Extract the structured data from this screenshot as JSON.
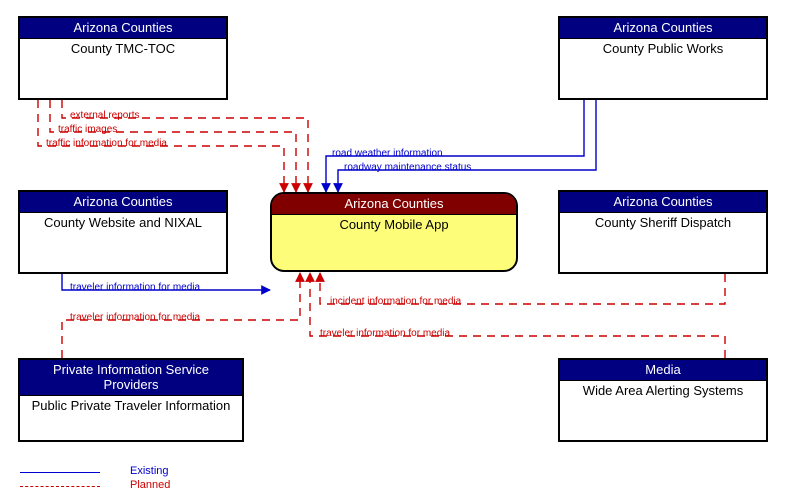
{
  "boxes": {
    "tmc": {
      "header": "Arizona Counties",
      "title": "County TMC-TOC"
    },
    "public_works": {
      "header": "Arizona Counties",
      "title": "County Public Works"
    },
    "website": {
      "header": "Arizona Counties",
      "title": "County Website and NIXAL"
    },
    "mobile": {
      "header": "Arizona Counties",
      "title": "County Mobile App"
    },
    "sheriff": {
      "header": "Arizona Counties",
      "title": "County Sheriff Dispatch"
    },
    "traveler_info": {
      "header": "Private Information Service Providers",
      "title": "Public  Private Traveler Information"
    },
    "media": {
      "header": "Media",
      "title": "Wide Area Alerting Systems"
    }
  },
  "flows": {
    "external_reports": "external reports",
    "traffic_images": "traffic images",
    "traffic_info_media": "traffic information for media",
    "road_weather": "road weather information",
    "roadway_maint": "roadway maintenance status",
    "traveler_info_media_1": "traveler information for media",
    "traveler_info_media_2": "traveler information for media",
    "incident_info": "incident information for media",
    "traveler_info_media_3": "traveler information for media"
  },
  "legend": {
    "existing": "Existing",
    "planned": "Planned"
  },
  "chart_data": {
    "type": "diagram",
    "title": "County Mobile App context diagram",
    "nodes": [
      {
        "id": "mobile",
        "label": "County Mobile App",
        "owner": "Arizona Counties",
        "role": "center"
      },
      {
        "id": "tmc",
        "label": "County TMC-TOC",
        "owner": "Arizona Counties"
      },
      {
        "id": "public_works",
        "label": "County Public Works",
        "owner": "Arizona Counties"
      },
      {
        "id": "website",
        "label": "County Website and NIXAL",
        "owner": "Arizona Counties"
      },
      {
        "id": "sheriff",
        "label": "County Sheriff Dispatch",
        "owner": "Arizona Counties"
      },
      {
        "id": "traveler_info",
        "label": "Public  Private Traveler Information",
        "owner": "Private Information Service Providers"
      },
      {
        "id": "media",
        "label": "Wide Area Alerting Systems",
        "owner": "Media"
      }
    ],
    "edges": [
      {
        "from": "tmc",
        "to": "mobile",
        "label": "external reports",
        "status": "Planned"
      },
      {
        "from": "tmc",
        "to": "mobile",
        "label": "traffic images",
        "status": "Planned"
      },
      {
        "from": "tmc",
        "to": "mobile",
        "label": "traffic information for media",
        "status": "Planned"
      },
      {
        "from": "public_works",
        "to": "mobile",
        "label": "road weather information",
        "status": "Existing"
      },
      {
        "from": "public_works",
        "to": "mobile",
        "label": "roadway maintenance status",
        "status": "Existing"
      },
      {
        "from": "website",
        "to": "mobile",
        "label": "traveler information for media",
        "status": "Existing"
      },
      {
        "from": "traveler_info",
        "to": "mobile",
        "label": "traveler information for media",
        "status": "Planned"
      },
      {
        "from": "sheriff",
        "to": "mobile",
        "label": "incident information for media",
        "status": "Planned"
      },
      {
        "from": "media",
        "to": "mobile",
        "label": "traveler information for media",
        "status": "Planned"
      }
    ],
    "legend": {
      "Existing": "solid blue",
      "Planned": "dashed red"
    }
  }
}
